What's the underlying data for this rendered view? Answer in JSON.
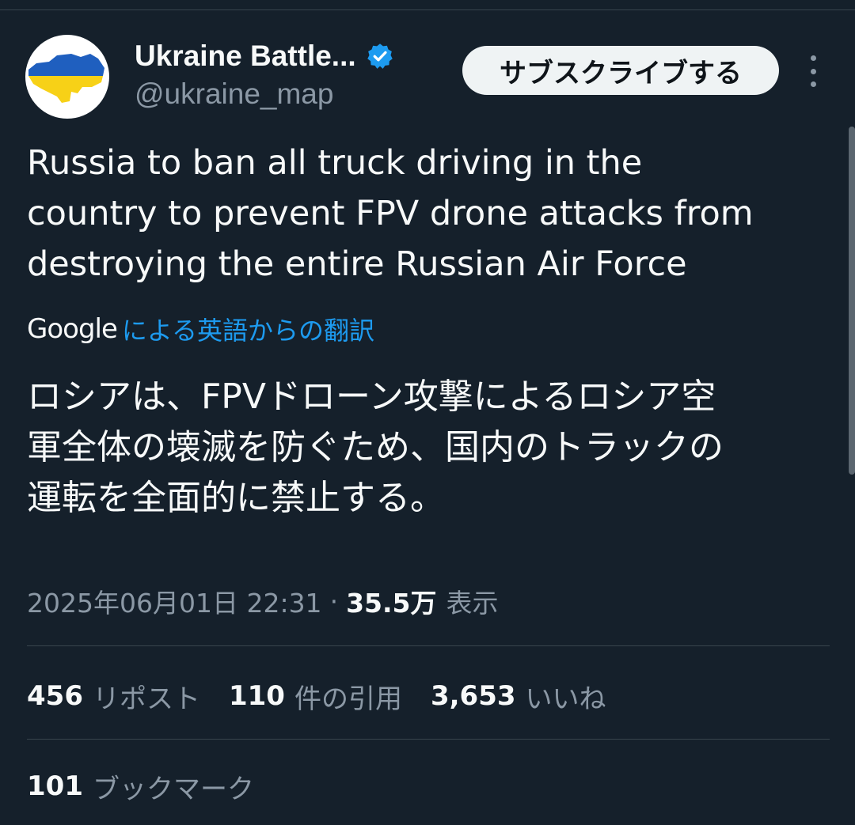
{
  "author": {
    "display_name": "Ukraine Battle...",
    "handle": "@ukraine_map",
    "verified": true,
    "avatar_icon": "ukraine-flag-map-icon"
  },
  "subscribe_label": "サブスクライブする",
  "tweet": {
    "text_lines": [
      "Russia to ban all truck driving in the",
      "country to prevent FPV drone attacks from",
      "destroying the entire Russian Air Force"
    ],
    "translation": {
      "provider": "Google",
      "link_text": "による英語からの翻訳"
    },
    "translated_lines": [
      "ロシアは、FPVドローン攻撃によるロシア空",
      "軍全体の壊滅を防ぐため、国内のトラックの",
      "運転を全面的に禁止する。"
    ],
    "timestamp": "2025年06月01日 22:31",
    "separator": "·",
    "views_count": "35.5万",
    "views_label": "表示"
  },
  "stats": {
    "reposts_count": "456",
    "reposts_label": "リポスト",
    "quotes_count": "110",
    "quotes_label": "件の引用",
    "likes_count": "3,653",
    "likes_label": "いいね",
    "bookmarks_count": "101",
    "bookmarks_label": "ブックマーク"
  },
  "colors": {
    "background": "#15202b",
    "text_primary": "#f7f9f9",
    "text_secondary": "#8b98a5",
    "link": "#1d9bf0",
    "verified_badge": "#1d9bf0",
    "flag_blue": "#1f5fbf",
    "flag_yellow": "#f7d117"
  }
}
